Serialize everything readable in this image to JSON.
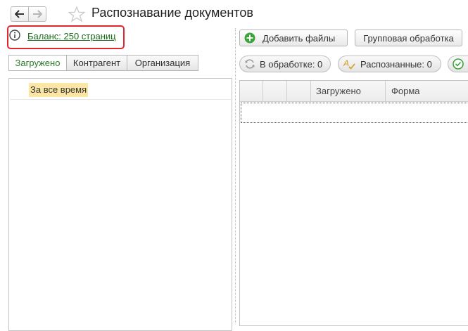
{
  "header": {
    "title": "Распознавание документов",
    "back_icon": "arrow-left-icon",
    "forward_icon": "arrow-right-icon",
    "favorite_icon": "star-icon"
  },
  "balance": {
    "icon": "info-icon",
    "link_text": "Баланс: 250 страниц",
    "highlight_color": "#e0262f",
    "link_color": "#1a6b1a"
  },
  "tabs": [
    {
      "label": "Загружено",
      "active": true
    },
    {
      "label": "Контрагент",
      "active": false
    },
    {
      "label": "Организация",
      "active": false
    }
  ],
  "filter_list": {
    "items": [
      "За все время"
    ],
    "selected_color": "#fbe7a3"
  },
  "toolbar": {
    "add_files_label": "Добавить файлы",
    "add_files_icon": "plus-circle-icon",
    "batch_processing_label": "Групповая обработка"
  },
  "status_pills": {
    "in_progress": {
      "label": "В обработке: 0",
      "icon": "refresh-icon"
    },
    "recognized": {
      "label": "Распознанные: 0",
      "icon": "spellcheck-icon"
    },
    "done": {
      "icon": "check-circle-icon"
    }
  },
  "table": {
    "columns": [
      "",
      "",
      "",
      "Загружено",
      "Форма"
    ],
    "rows": []
  }
}
